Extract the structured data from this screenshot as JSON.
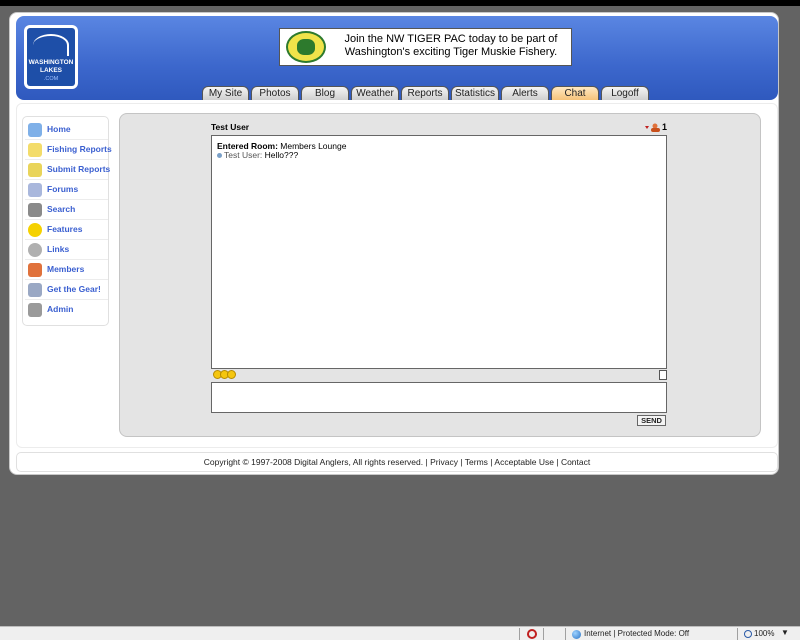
{
  "logo": {
    "line1": "WASHINGTON",
    "line2": "LAKES",
    "line3": ".COM"
  },
  "banner": {
    "text": "Join the NW TIGER PAC today to be part of Washington's exciting Tiger Muskie Fishery."
  },
  "tabs": [
    {
      "label": "My Site"
    },
    {
      "label": "Photos"
    },
    {
      "label": "Blog"
    },
    {
      "label": "Weather"
    },
    {
      "label": "Reports"
    },
    {
      "label": "Statistics"
    },
    {
      "label": "Alerts"
    },
    {
      "label": "Chat",
      "active": true
    },
    {
      "label": "Logoff"
    }
  ],
  "sidebar": {
    "items": [
      {
        "label": "Home",
        "icon": "house-icon"
      },
      {
        "label": "Fishing Reports",
        "icon": "notepad-icon"
      },
      {
        "label": "Submit Reports",
        "icon": "notepad-add-icon"
      },
      {
        "label": "Forums",
        "icon": "forum-icon"
      },
      {
        "label": "Search",
        "icon": "binoculars-icon"
      },
      {
        "label": "Features",
        "icon": "star-icon"
      },
      {
        "label": "Links",
        "icon": "chain-link-icon"
      },
      {
        "label": "Members",
        "icon": "people-icon"
      },
      {
        "label": "Get the Gear!",
        "icon": "cart-icon"
      },
      {
        "label": "Admin",
        "icon": "wrench-icon"
      }
    ]
  },
  "chat": {
    "title": "Test User",
    "user_count": "1",
    "log": {
      "entered_label": "Entered Room:",
      "room_name": "Members Lounge",
      "message_user": "Test User:",
      "message_text": "Hello???"
    },
    "input_value": "",
    "send_label": "SEND"
  },
  "footer": {
    "copyright": "Copyright © 1997-2008 Digital Anglers, All rights reserved.",
    "sep": "|",
    "links": [
      "Privacy",
      "Terms",
      "Acceptable Use",
      "Contact"
    ]
  },
  "statusbar": {
    "zone": "Internet | Protected Mode: Off",
    "zoom": "100%"
  }
}
